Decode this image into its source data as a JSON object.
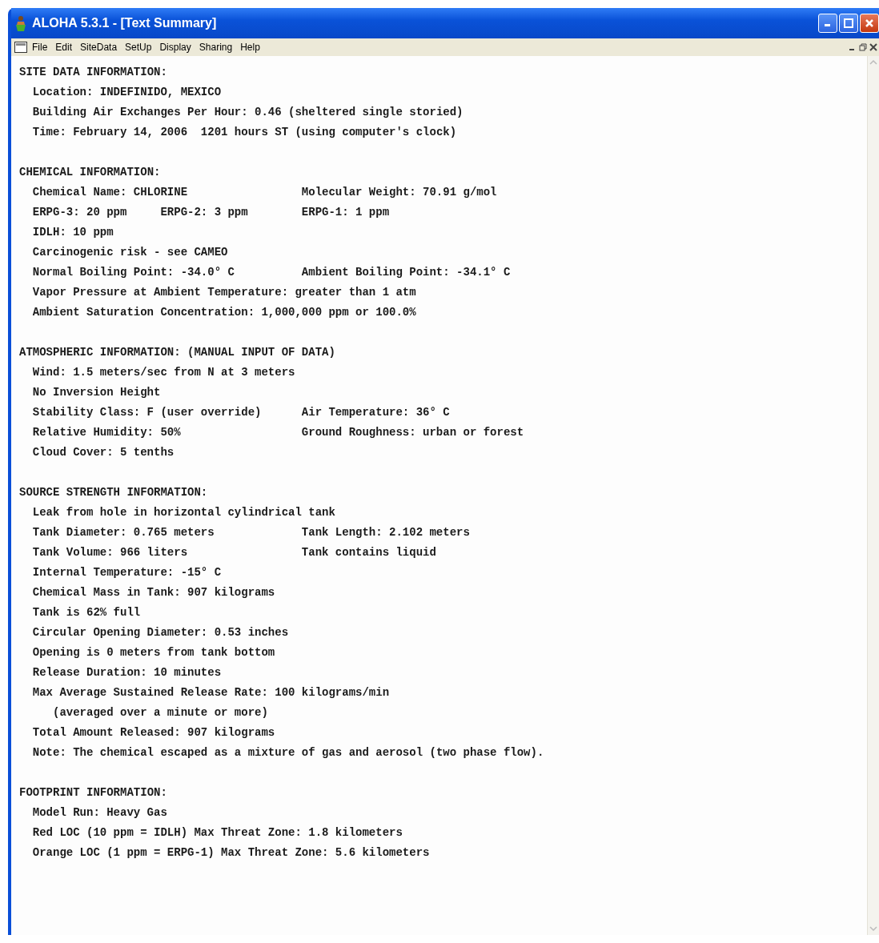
{
  "window": {
    "title": "ALOHA 5.3.1 - [Text Summary]"
  },
  "menu": [
    "File",
    "Edit",
    "SiteData",
    "SetUp",
    "Display",
    "Sharing",
    "Help"
  ],
  "sections": [
    {
      "heading": "SITE DATA INFORMATION:",
      "lines": [
        {
          "kind": "item",
          "cells": [
            "Location: INDEFINIDO, MEXICO"
          ]
        },
        {
          "kind": "item",
          "cells": [
            "Building Air Exchanges Per Hour: 0.46 (sheltered single storied)"
          ]
        },
        {
          "kind": "item",
          "cells": [
            "Time: February 14, 2006  1201 hours ST (using computer's clock)"
          ]
        }
      ]
    },
    {
      "heading": "CHEMICAL INFORMATION:",
      "lines": [
        {
          "kind": "item",
          "cells": [
            "Chemical Name: CHLORINE",
            "Molecular Weight: 70.91 g/mol"
          ]
        },
        {
          "kind": "item",
          "cells": [
            "ERPG-3: 20 ppm",
            "ERPG-2: 3 ppm",
            "ERPG-1: 1 ppm"
          ]
        },
        {
          "kind": "item",
          "cells": [
            "IDLH: 10 ppm"
          ]
        },
        {
          "kind": "item",
          "cells": [
            "Carcinogenic risk - see CAMEO"
          ]
        },
        {
          "kind": "item",
          "cells": [
            "Normal Boiling Point: -34.0° C",
            "Ambient Boiling Point: -34.1° C"
          ]
        },
        {
          "kind": "item",
          "cells": [
            "Vapor Pressure at Ambient Temperature: greater than 1 atm"
          ]
        },
        {
          "kind": "item",
          "cells": [
            "Ambient Saturation Concentration: 1,000,000 ppm or 100.0%"
          ]
        }
      ]
    },
    {
      "heading": "ATMOSPHERIC INFORMATION: (MANUAL INPUT OF DATA)",
      "lines": [
        {
          "kind": "item",
          "cells": [
            "Wind: 1.5 meters/sec from N at 3 meters"
          ]
        },
        {
          "kind": "item",
          "cells": [
            "No Inversion Height"
          ]
        },
        {
          "kind": "item",
          "cells": [
            "Stability Class: F (user override)",
            "Air Temperature: 36° C"
          ]
        },
        {
          "kind": "item",
          "cells": [
            "Relative Humidity: 50%",
            "Ground Roughness: urban or forest"
          ]
        },
        {
          "kind": "item",
          "cells": [
            "Cloud Cover: 5 tenths"
          ]
        }
      ]
    },
    {
      "heading": "SOURCE STRENGTH INFORMATION:",
      "lines": [
        {
          "kind": "item",
          "cells": [
            "Leak from hole in horizontal cylindrical tank"
          ]
        },
        {
          "kind": "item",
          "cells": [
            "Tank Diameter: 0.765 meters",
            "Tank Length: 2.102 meters"
          ]
        },
        {
          "kind": "item",
          "cells": [
            "Tank Volume: 966 liters",
            "Tank contains liquid"
          ]
        },
        {
          "kind": "item",
          "cells": [
            "Internal Temperature: -15° C"
          ]
        },
        {
          "kind": "item",
          "cells": [
            "Chemical Mass in Tank: 907 kilograms"
          ]
        },
        {
          "kind": "item",
          "cells": [
            "Tank is 62% full"
          ]
        },
        {
          "kind": "item",
          "cells": [
            "Circular Opening Diameter: 0.53 inches"
          ]
        },
        {
          "kind": "item",
          "cells": [
            "Opening is 0 meters from tank bottom"
          ]
        },
        {
          "kind": "item",
          "cells": [
            "Release Duration: 10 minutes"
          ]
        },
        {
          "kind": "item",
          "cells": [
            "Max Average Sustained Release Rate: 100 kilograms/min"
          ]
        },
        {
          "kind": "continuation",
          "cells": [
            "(averaged over a minute or more)"
          ]
        },
        {
          "kind": "item",
          "cells": [
            "Total Amount Released: 907 kilograms"
          ]
        },
        {
          "kind": "item",
          "cells": [
            "Note: The chemical escaped as a mixture of gas and aerosol (two phase flow)."
          ]
        }
      ]
    },
    {
      "heading": "FOOTPRINT INFORMATION:",
      "lines": [
        {
          "kind": "item",
          "cells": [
            "Model Run: Heavy Gas"
          ]
        },
        {
          "kind": "item",
          "cells": [
            "Red LOC (10 ppm = IDLH) Max Threat Zone: 1.8 kilometers"
          ]
        },
        {
          "kind": "item",
          "cells": [
            "Orange LOC (1 ppm = ERPG-1) Max Threat Zone: 5.6 kilometers"
          ]
        }
      ]
    }
  ]
}
